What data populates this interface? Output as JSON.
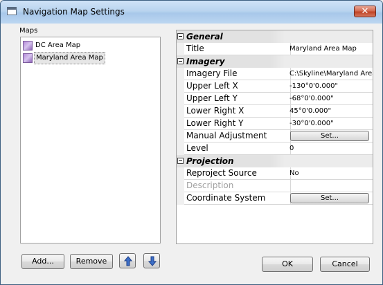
{
  "window": {
    "title": "Navigation Map Settings",
    "close_label": "✕"
  },
  "maps": {
    "label": "Maps",
    "items": [
      {
        "label": "DC Area Map",
        "selected": false
      },
      {
        "label": "Maryland Area Map",
        "selected": true
      }
    ],
    "add_label": "Add...",
    "remove_label": "Remove",
    "move_up_icon": "arrow-up-icon",
    "move_down_icon": "arrow-down-icon"
  },
  "properties": {
    "general": {
      "label": "General",
      "title": {
        "name": "Title",
        "value": "Maryland Area Map"
      }
    },
    "imagery": {
      "label": "Imagery",
      "imagery_file": {
        "name": "Imagery File",
        "value": "C:\\Skyline\\Maryland Area"
      },
      "upper_left_x": {
        "name": "Upper Left X",
        "value": "-130°0'0.000\""
      },
      "upper_left_y": {
        "name": "Upper Left Y",
        "value": "-68°0'0.000\""
      },
      "lower_right_x": {
        "name": "Lower Right X",
        "value": "45°0'0.000\""
      },
      "lower_right_y": {
        "name": "Lower Right Y",
        "value": "-30°0'0.000\""
      },
      "manual_adjustment": {
        "name": "Manual Adjustment",
        "button": "Set..."
      },
      "level": {
        "name": "Level",
        "value": "0"
      }
    },
    "projection": {
      "label": "Projection",
      "reproject_source": {
        "name": "Reproject Source",
        "value": "No"
      },
      "description": {
        "name": "Description",
        "value": ""
      },
      "coordinate_system": {
        "name": "Coordinate System",
        "button": "Set..."
      }
    }
  },
  "footer": {
    "ok_label": "OK",
    "cancel_label": "Cancel"
  }
}
